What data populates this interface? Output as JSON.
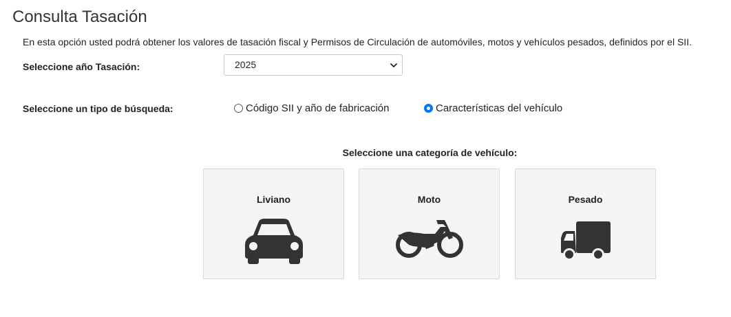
{
  "page": {
    "title": "Consulta Tasación",
    "description": "En esta opción usted podrá obtener los valores de tasación fiscal y Permisos de Circulación de automóviles, motos y vehículos pesados, definidos por el SII."
  },
  "form": {
    "year_label": "Seleccione año Tasación:",
    "year_value": "2025",
    "search_type_label": "Seleccione un tipo de búsqueda:",
    "search_options": [
      {
        "label": "Código SII y año de fabricación",
        "checked": false
      },
      {
        "label": "Características del vehículo",
        "checked": true
      }
    ]
  },
  "categories": {
    "title": "Seleccione una categoría de vehículo:",
    "items": [
      {
        "label": "Liviano",
        "icon": "car-icon"
      },
      {
        "label": "Moto",
        "icon": "motorcycle-icon"
      },
      {
        "label": "Pesado",
        "icon": "truck-icon"
      }
    ]
  },
  "colors": {
    "accent": "#0075ff",
    "card_bg": "#f4f4f4",
    "icon": "#333333"
  }
}
